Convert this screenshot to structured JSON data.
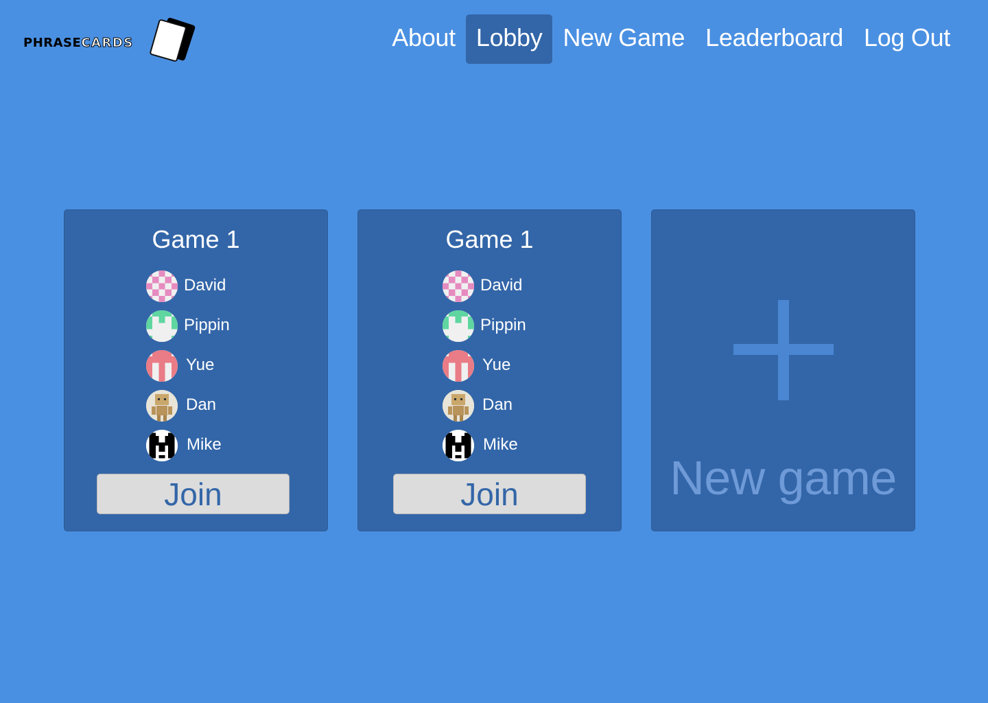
{
  "app": {
    "logo_text_part1": "PHRASE",
    "logo_text_part2": "CARDS"
  },
  "nav": {
    "items": [
      {
        "label": "About"
      },
      {
        "label": "Lobby",
        "active": true
      },
      {
        "label": "New Game"
      },
      {
        "label": "Leaderboard"
      },
      {
        "label": "Log Out"
      }
    ]
  },
  "games": [
    {
      "title": "Game 1",
      "players": [
        {
          "name": "David",
          "avatar": "pink-checker-identicon"
        },
        {
          "name": "Pippin",
          "avatar": "green-identicon"
        },
        {
          "name": "Yue",
          "avatar": "red-identicon"
        },
        {
          "name": "Dan",
          "avatar": "cardboard-robot-photo"
        },
        {
          "name": "Mike",
          "avatar": "black-white-m-identicon"
        }
      ],
      "join_label": "Join"
    },
    {
      "title": "Game 1",
      "players": [
        {
          "name": "David",
          "avatar": "pink-checker-identicon"
        },
        {
          "name": "Pippin",
          "avatar": "green-identicon"
        },
        {
          "name": "Yue",
          "avatar": "red-identicon"
        },
        {
          "name": "Dan",
          "avatar": "cardboard-robot-photo"
        },
        {
          "name": "Mike",
          "avatar": "black-white-m-identicon"
        }
      ],
      "join_label": "Join"
    }
  ],
  "new_game_card": {
    "label": "New game",
    "icon": "plus-icon"
  },
  "colors": {
    "background": "#4a90e2",
    "card": "#3366a8",
    "nav_active": "#3366a8",
    "button": "#dcdcdc"
  }
}
